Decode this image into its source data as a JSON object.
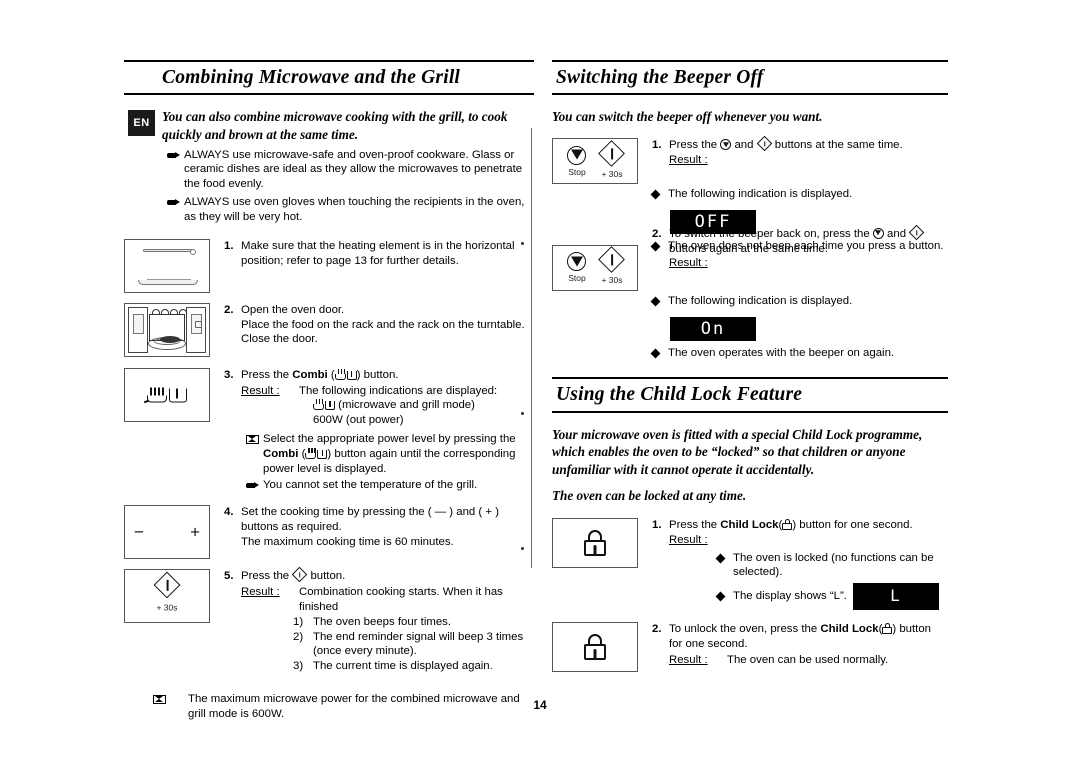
{
  "page": {
    "number": "14",
    "language_badge": "EN"
  },
  "left_column": {
    "heading": "Combining Microwave and the Grill",
    "lead": "You can also combine microwave cooking with the grill, to cook quickly and brown at the same time.",
    "cautions": [
      "ALWAYS use microwave-safe and oven-proof cookware. Glass or ceramic dishes are ideal as they allow the microwaves to penetrate the food evenly.",
      "ALWAYS use oven gloves when touching the recipients in the oven, as they will be very hot."
    ],
    "steps": [
      {
        "num": "1.",
        "figure": "heating-element",
        "text": "Make sure that the heating element is in the horizontal position; refer to page 13 for further details."
      },
      {
        "num": "2.",
        "figure": "oven-interior",
        "text_lines": [
          "Open the oven door.",
          "Place the food on the rack and the rack on the turntable.",
          "Close the door."
        ]
      },
      {
        "num": "3.",
        "figure": "combi-symbol",
        "text_prefix": "Press the ",
        "text_bold": "Combi",
        "text_suffix": ") button.",
        "result_label": "Result :",
        "result_text": "The following indications are displayed:",
        "result_sub1": "(microwave and grill mode)",
        "result_sub2": "600W (out power)",
        "note_mw": "Select the appropriate power level by pressing the",
        "note_mw_bold": "Combi",
        "note_mw_cont": ") button again until the corresponding power level is displayed.",
        "note_hand": "You cannot set the temperature of the grill."
      },
      {
        "num": "4.",
        "figure": "minus-plus",
        "text_lines": [
          "Set the cooking time by pressing the ( — ) and ( + ) buttons as required.",
          "The maximum cooking time is 60 minutes."
        ]
      },
      {
        "num": "5.",
        "figure": "start-30s",
        "text_prefix": "Press the ",
        "text_suffix": " button.",
        "result_label": "Result :",
        "result_text": "Combination cooking starts. When it has finished",
        "numbered": [
          {
            "n": "1)",
            "t": "The oven beeps four times."
          },
          {
            "n": "2)",
            "t": "The end reminder signal will beep 3 times (once every minute)."
          },
          {
            "n": "3)",
            "t": "The current time is displayed again."
          }
        ]
      }
    ],
    "footer_note": "The maximum microwave power for the combined microwave and grill mode is 600W."
  },
  "right_column": {
    "beeper": {
      "heading": "Switching the Beeper Off",
      "lead": "You can switch the beeper off whenever you want.",
      "steps": [
        {
          "num": "1.",
          "figure": "stop-start-pair",
          "text_prefix": "Press the ",
          "text_mid": " and ",
          "text_suffix": " buttons at the same time.",
          "result_label": "Result :",
          "bullet1": "The following indication is displayed.",
          "lcd": "OFF",
          "bullet2": "The oven does not beep each time you press a button."
        },
        {
          "num": "2.",
          "figure": "stop-start-pair",
          "text_prefix": "To switch the beeper back on, press the ",
          "text_mid": " and ",
          "text_suffix": " buttons again at the same time.",
          "result_label": "Result :",
          "bullet1": "The following indication is displayed.",
          "lcd": "On",
          "bullet2": "The oven operates with the beeper on again."
        }
      ]
    },
    "child_lock": {
      "heading": "Using the Child Lock Feature",
      "lead": "Your microwave oven is fitted with a special Child Lock programme, which enables the oven to be “locked” so that children or anyone unfamiliar with it cannot operate it accidentally.",
      "lead2": "The oven can be locked at any time.",
      "steps": [
        {
          "num": "1.",
          "figure": "padlock",
          "text_prefix": "Press the ",
          "text_bold": "Child Lock",
          "text_suffix": ") button for one second.",
          "result_label": "Result :",
          "bullet1": "The oven is locked (no functions can be selected).",
          "bullet2": "The display shows “L”.",
          "lcd": "L"
        },
        {
          "num": "2.",
          "figure": "padlock",
          "text_prefix": "To unlock the oven, press the ",
          "text_bold": "Child Lock",
          "text_suffix": ") button for one second.",
          "result_label": "Result :",
          "result_text": "The oven can be used normally."
        }
      ]
    }
  },
  "buttons": {
    "stop_label": "Stop",
    "start_label": "+ 30s",
    "minus": "−",
    "plus": "+"
  }
}
